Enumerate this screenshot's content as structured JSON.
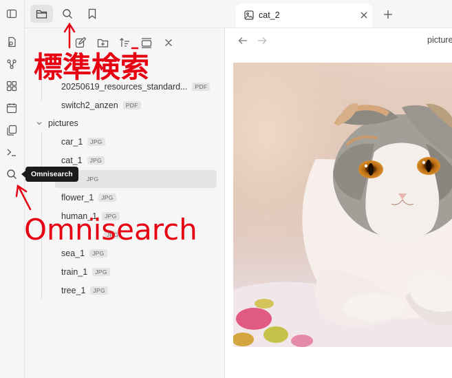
{
  "sidebar": {
    "tree": {
      "files_top": [
        {
          "name": "20250619_resources_standard...",
          "ext": "PDF"
        },
        {
          "name": "switch2_anzen",
          "ext": "PDF"
        }
      ],
      "folder": "pictures",
      "files": [
        {
          "name": "car_1",
          "ext": "JPG"
        },
        {
          "name": "cat_1",
          "ext": "JPG"
        },
        {
          "name": "",
          "ext": "JPG"
        },
        {
          "name": "flower_1",
          "ext": "JPG"
        },
        {
          "name": "human_1",
          "ext": "JPG"
        },
        {
          "name": "",
          "ext": "JPG"
        },
        {
          "name": "sea_1",
          "ext": "JPG"
        },
        {
          "name": "train_1",
          "ext": "JPG"
        },
        {
          "name": "tree_1",
          "ext": "JPG"
        }
      ]
    }
  },
  "tooltip": "Omnisearch",
  "tab": {
    "title": "cat_2"
  },
  "header": {
    "breadcrumb": "picture"
  },
  "annotations": {
    "standard_search": "標準検索",
    "omnisearch": "Omnisearch"
  },
  "colors": {
    "annotation": "#e60012",
    "sidebar_bg": "#f6f6f6",
    "tooltip_bg": "#1b1b1b"
  },
  "icons": [
    "sidebar-toggle-icon",
    "quick-switcher-icon",
    "graph-icon",
    "canvas-icon",
    "calendar-icon",
    "templates-icon",
    "terminal-icon",
    "search-icon",
    "folder-icon",
    "bookmark-icon",
    "new-note-icon",
    "new-folder-icon",
    "sort-icon",
    "collapse-icon",
    "close-icon",
    "image-icon",
    "arrow-left-icon",
    "arrow-right-icon",
    "plus-icon",
    "chevron-down-icon"
  ]
}
